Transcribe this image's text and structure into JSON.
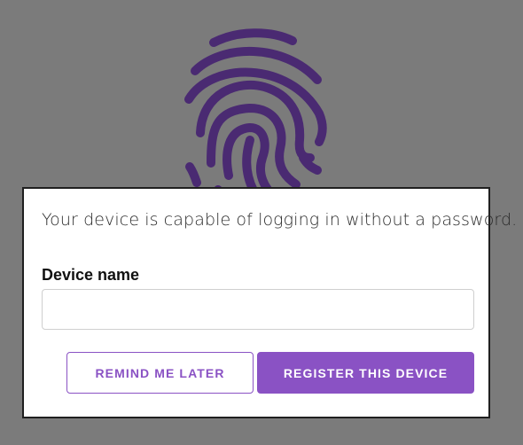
{
  "background": {
    "overlay_color": "#7b7b7b",
    "icon": "fingerprint-icon",
    "icon_color": "#4a2a72"
  },
  "dialog": {
    "message": "Your device is capable of logging in without a password.",
    "device_name": {
      "label": "Device name",
      "value": "",
      "placeholder": ""
    },
    "buttons": {
      "remind_later": "REMIND ME LATER",
      "register": "REGISTER THIS DEVICE"
    },
    "accent_color": "#8a52c4"
  }
}
